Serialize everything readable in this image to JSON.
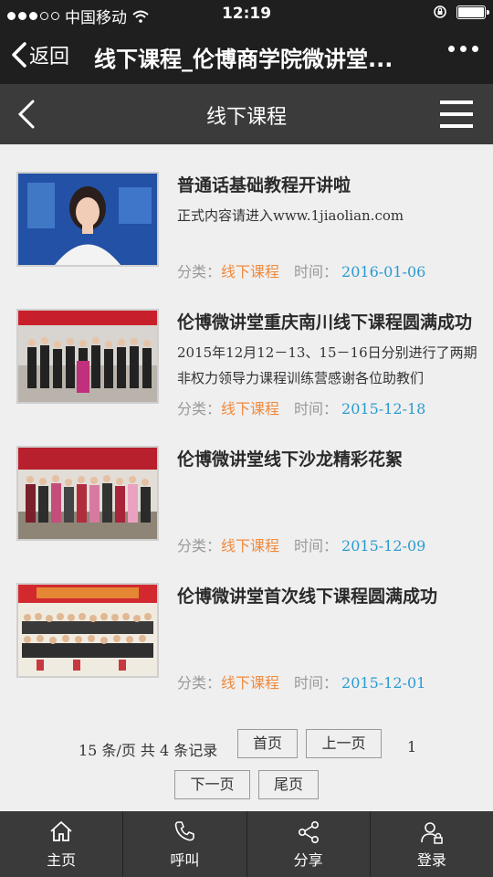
{
  "status_bar": {
    "carrier": "中国移动",
    "time": "12:19"
  },
  "wechat_bar": {
    "back_label": "返回",
    "title": "线下课程_伦博商学院微讲堂..."
  },
  "site_header": {
    "title": "线下课程"
  },
  "articles": [
    {
      "title": "普通话基础教程开讲啦",
      "excerpt": "正式内容请进入www.1jiaolian.com",
      "category_label": "分类：",
      "category": "线下课程",
      "time_label": "时间：",
      "date": "2016-01-06"
    },
    {
      "title": "伦博微讲堂重庆南川线下课程圆满成功",
      "excerpt": "2015年12月12－13、15－16日分别进行了两期非权力领导力课程训练营感谢各位助教们",
      "category_label": "分类：",
      "category": "线下课程",
      "time_label": "时间：",
      "date": "2015-12-18"
    },
    {
      "title": "伦博微讲堂线下沙龙精彩花絮",
      "excerpt": "",
      "category_label": "分类：",
      "category": "线下课程",
      "time_label": "时间：",
      "date": "2015-12-09"
    },
    {
      "title": "伦博微讲堂首次线下课程圆满成功",
      "excerpt": "",
      "category_label": "分类：",
      "category": "线下课程",
      "time_label": "时间：",
      "date": "2015-12-01"
    }
  ],
  "pagination": {
    "info": "15 条/页 共 4 条记录",
    "first": "首页",
    "prev": "上一页",
    "current": "1",
    "next": "下一页",
    "last": "尾页"
  },
  "tab_bar": [
    {
      "label": "主页",
      "icon": "home-icon"
    },
    {
      "label": "呼叫",
      "icon": "phone-icon"
    },
    {
      "label": "分享",
      "icon": "share-icon"
    },
    {
      "label": "登录",
      "icon": "user-login-icon"
    }
  ],
  "colors": {
    "category": "#f08a3c",
    "date": "#2a9bd1",
    "header_dark": "#1f1f1f",
    "header_gray": "#3b3b3b",
    "tabbar": "#3a3a3a"
  }
}
